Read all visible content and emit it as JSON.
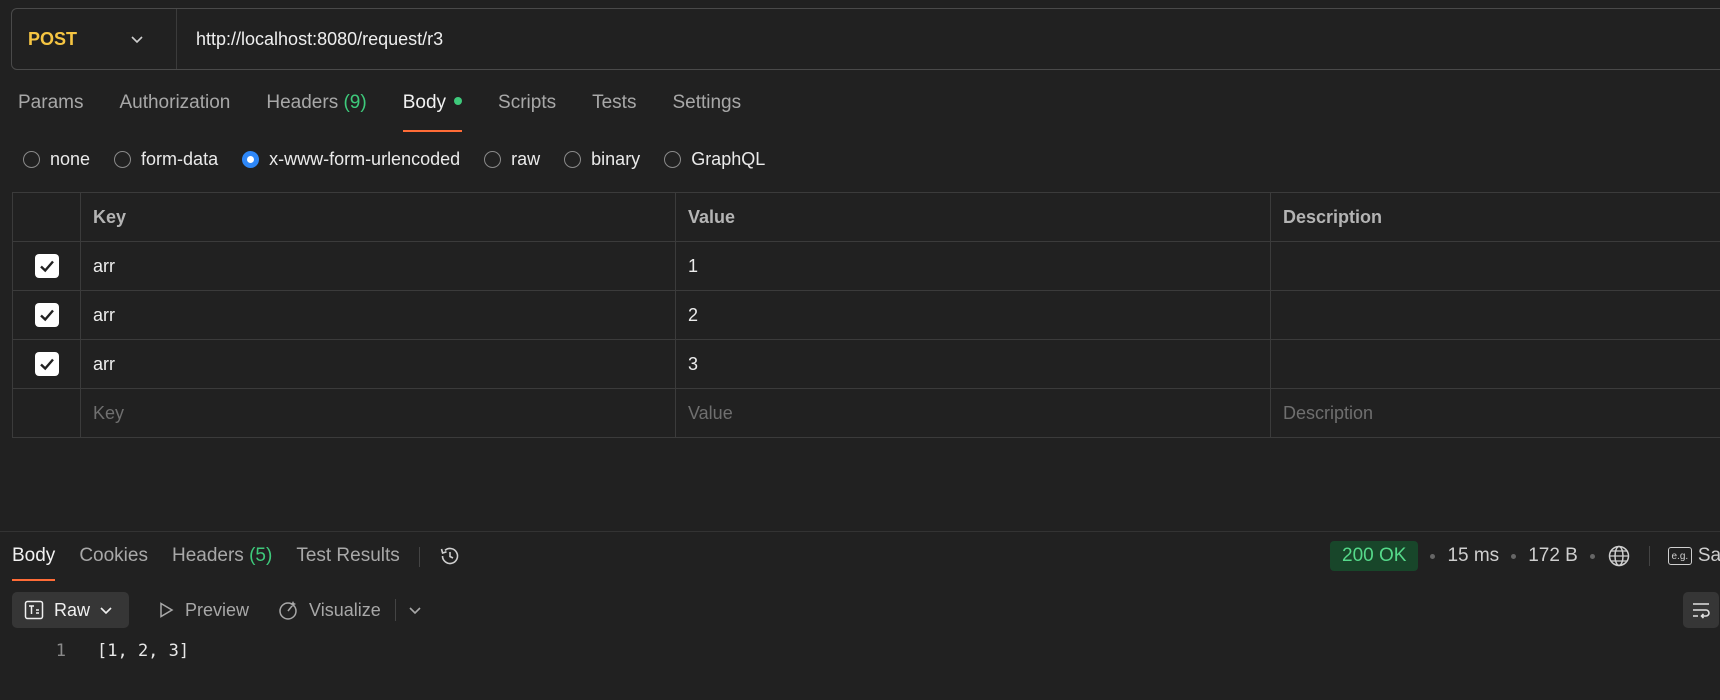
{
  "request": {
    "method": "POST",
    "url": "http://localhost:8080/request/r3"
  },
  "request_tabs": [
    {
      "label": "Params",
      "count": ""
    },
    {
      "label": "Authorization",
      "count": ""
    },
    {
      "label": "Headers",
      "count": "(9)"
    },
    {
      "label": "Body",
      "count": "",
      "active": true
    },
    {
      "label": "Scripts",
      "count": ""
    },
    {
      "label": "Tests",
      "count": ""
    },
    {
      "label": "Settings",
      "count": ""
    }
  ],
  "body_types": [
    {
      "label": "none"
    },
    {
      "label": "form-data"
    },
    {
      "label": "x-www-form-urlencoded",
      "selected": true
    },
    {
      "label": "raw"
    },
    {
      "label": "binary"
    },
    {
      "label": "GraphQL"
    }
  ],
  "table": {
    "headers": {
      "key": "Key",
      "value": "Value",
      "description": "Description"
    },
    "rows": [
      {
        "key": "arr",
        "value": "1",
        "description": ""
      },
      {
        "key": "arr",
        "value": "2",
        "description": ""
      },
      {
        "key": "arr",
        "value": "3",
        "description": ""
      }
    ],
    "placeholder": {
      "key": "Key",
      "value": "Value",
      "description": "Description"
    }
  },
  "response_tabs": [
    {
      "label": "Body",
      "count": "",
      "active": true
    },
    {
      "label": "Cookies",
      "count": ""
    },
    {
      "label": "Headers",
      "count": "(5)"
    },
    {
      "label": "Test Results",
      "count": ""
    }
  ],
  "response_status": {
    "status": "200 OK",
    "time": "15 ms",
    "size": "172 B",
    "eg_label": "e.g.",
    "save_partial": "Sa"
  },
  "response_toolbar": {
    "raw": "Raw",
    "preview": "Preview",
    "visualize": "Visualize"
  },
  "response_body": {
    "line_number": "1",
    "content": "[1, 2, 3]"
  },
  "colors": {
    "method": "#f5c542",
    "accent": "#ff6c37",
    "success": "#3ec97b",
    "radio_selected": "#2e87f7"
  }
}
